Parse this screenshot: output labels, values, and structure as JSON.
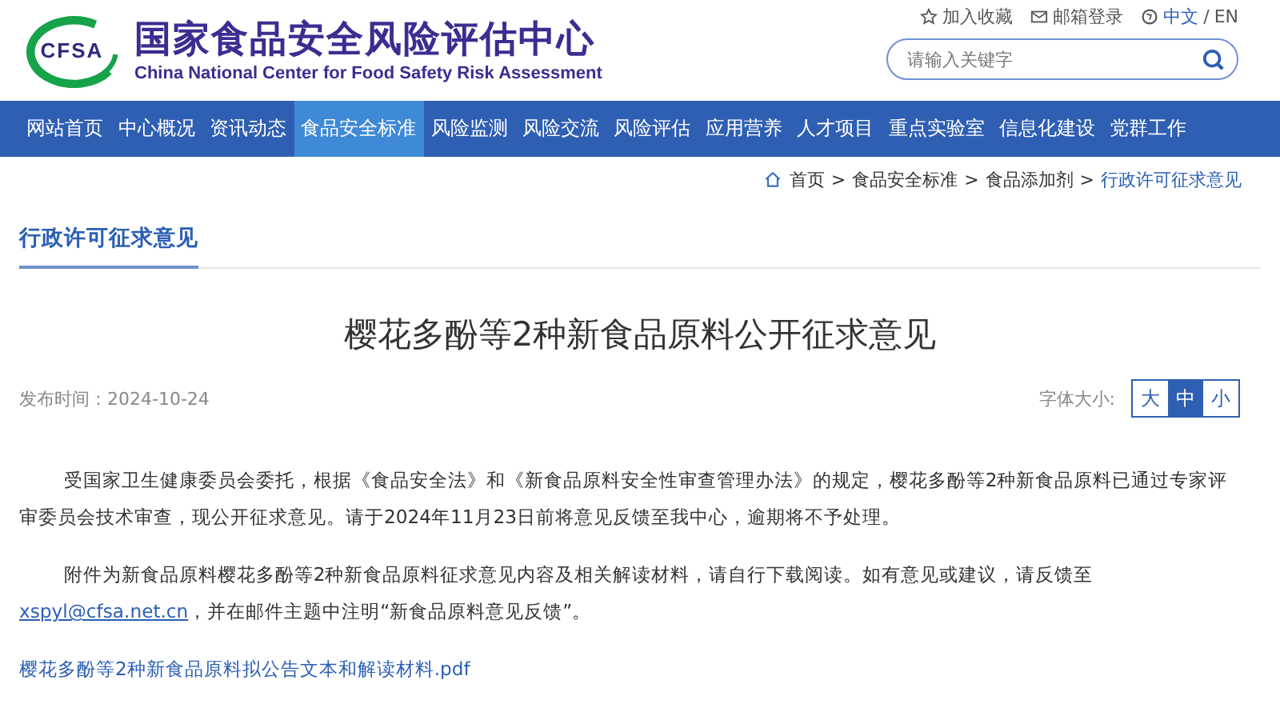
{
  "header": {
    "logo_text": "CFSA",
    "title": "国家食品安全风险评估中心",
    "subtitle": "China National Center for Food Safety Risk Assessment",
    "links": [
      {
        "kind": "star",
        "label": "加入收藏",
        "selected": false
      },
      {
        "kind": "mail",
        "label": "邮箱登录",
        "selected": false
      },
      {
        "kind": "globe",
        "label": "中文",
        "selected": true
      }
    ],
    "lang_sep": "/",
    "lang_alt": "EN",
    "search": {
      "placeholder": "请输入关键字"
    }
  },
  "nav": [
    {
      "label": "网站首页",
      "selected": false
    },
    {
      "label": "中心概况",
      "selected": false
    },
    {
      "label": "资讯动态",
      "selected": false
    },
    {
      "label": "食品安全标准",
      "selected": true
    },
    {
      "label": "风险监测",
      "selected": false
    },
    {
      "label": "风险交流",
      "selected": false
    },
    {
      "label": "风险评估",
      "selected": false
    },
    {
      "label": "应用营养",
      "selected": false
    },
    {
      "label": "人才项目",
      "selected": false
    },
    {
      "label": "重点实验室",
      "selected": false
    },
    {
      "label": "信息化建设",
      "selected": false
    },
    {
      "label": "党群工作",
      "selected": false
    }
  ],
  "breadcrumb": [
    {
      "label": "首页",
      "current": false
    },
    {
      "label": "食品安全标准",
      "current": false
    },
    {
      "label": "食品添加剂",
      "current": false
    },
    {
      "label": "行政许可征求意见",
      "current": true
    }
  ],
  "breadcrumb_sep": ">",
  "section_title": "行政许可征求意见",
  "article": {
    "title": "樱花多酚等2种新食品原料公开征求意见",
    "date_label": "发布时间：",
    "date": "2024-10-24",
    "font_size_label": "字体大小:",
    "font_sizes": [
      {
        "label": "大",
        "selected": false
      },
      {
        "label": "中",
        "selected": true
      },
      {
        "label": "小",
        "selected": false
      }
    ],
    "paragraphs": [
      {
        "before": "受国家卫生健康委员会委托，根据《食品安全法》和《新食品原料安全性审查管理办法》的规定，樱花多酚等2种新食品原料已通过专家评审委员会技术审查，现公开征求意见。请于2024年11月23日前将意见反馈至我中心，逾期将不予处理。"
      },
      {
        "before": "附件为新食品原料樱花多酚等2种新食品原料征求意见内容及相关解读材料，请自行下载阅读。如有意见或建议，请反馈至",
        "link": "xspyl@cfsa.net.cn",
        "after": "，并在邮件主题中注明“新食品原料意见反馈”。"
      }
    ],
    "attachment": "樱花多酚等2种新食品原料拟公告文本和解读材料.pdf"
  }
}
